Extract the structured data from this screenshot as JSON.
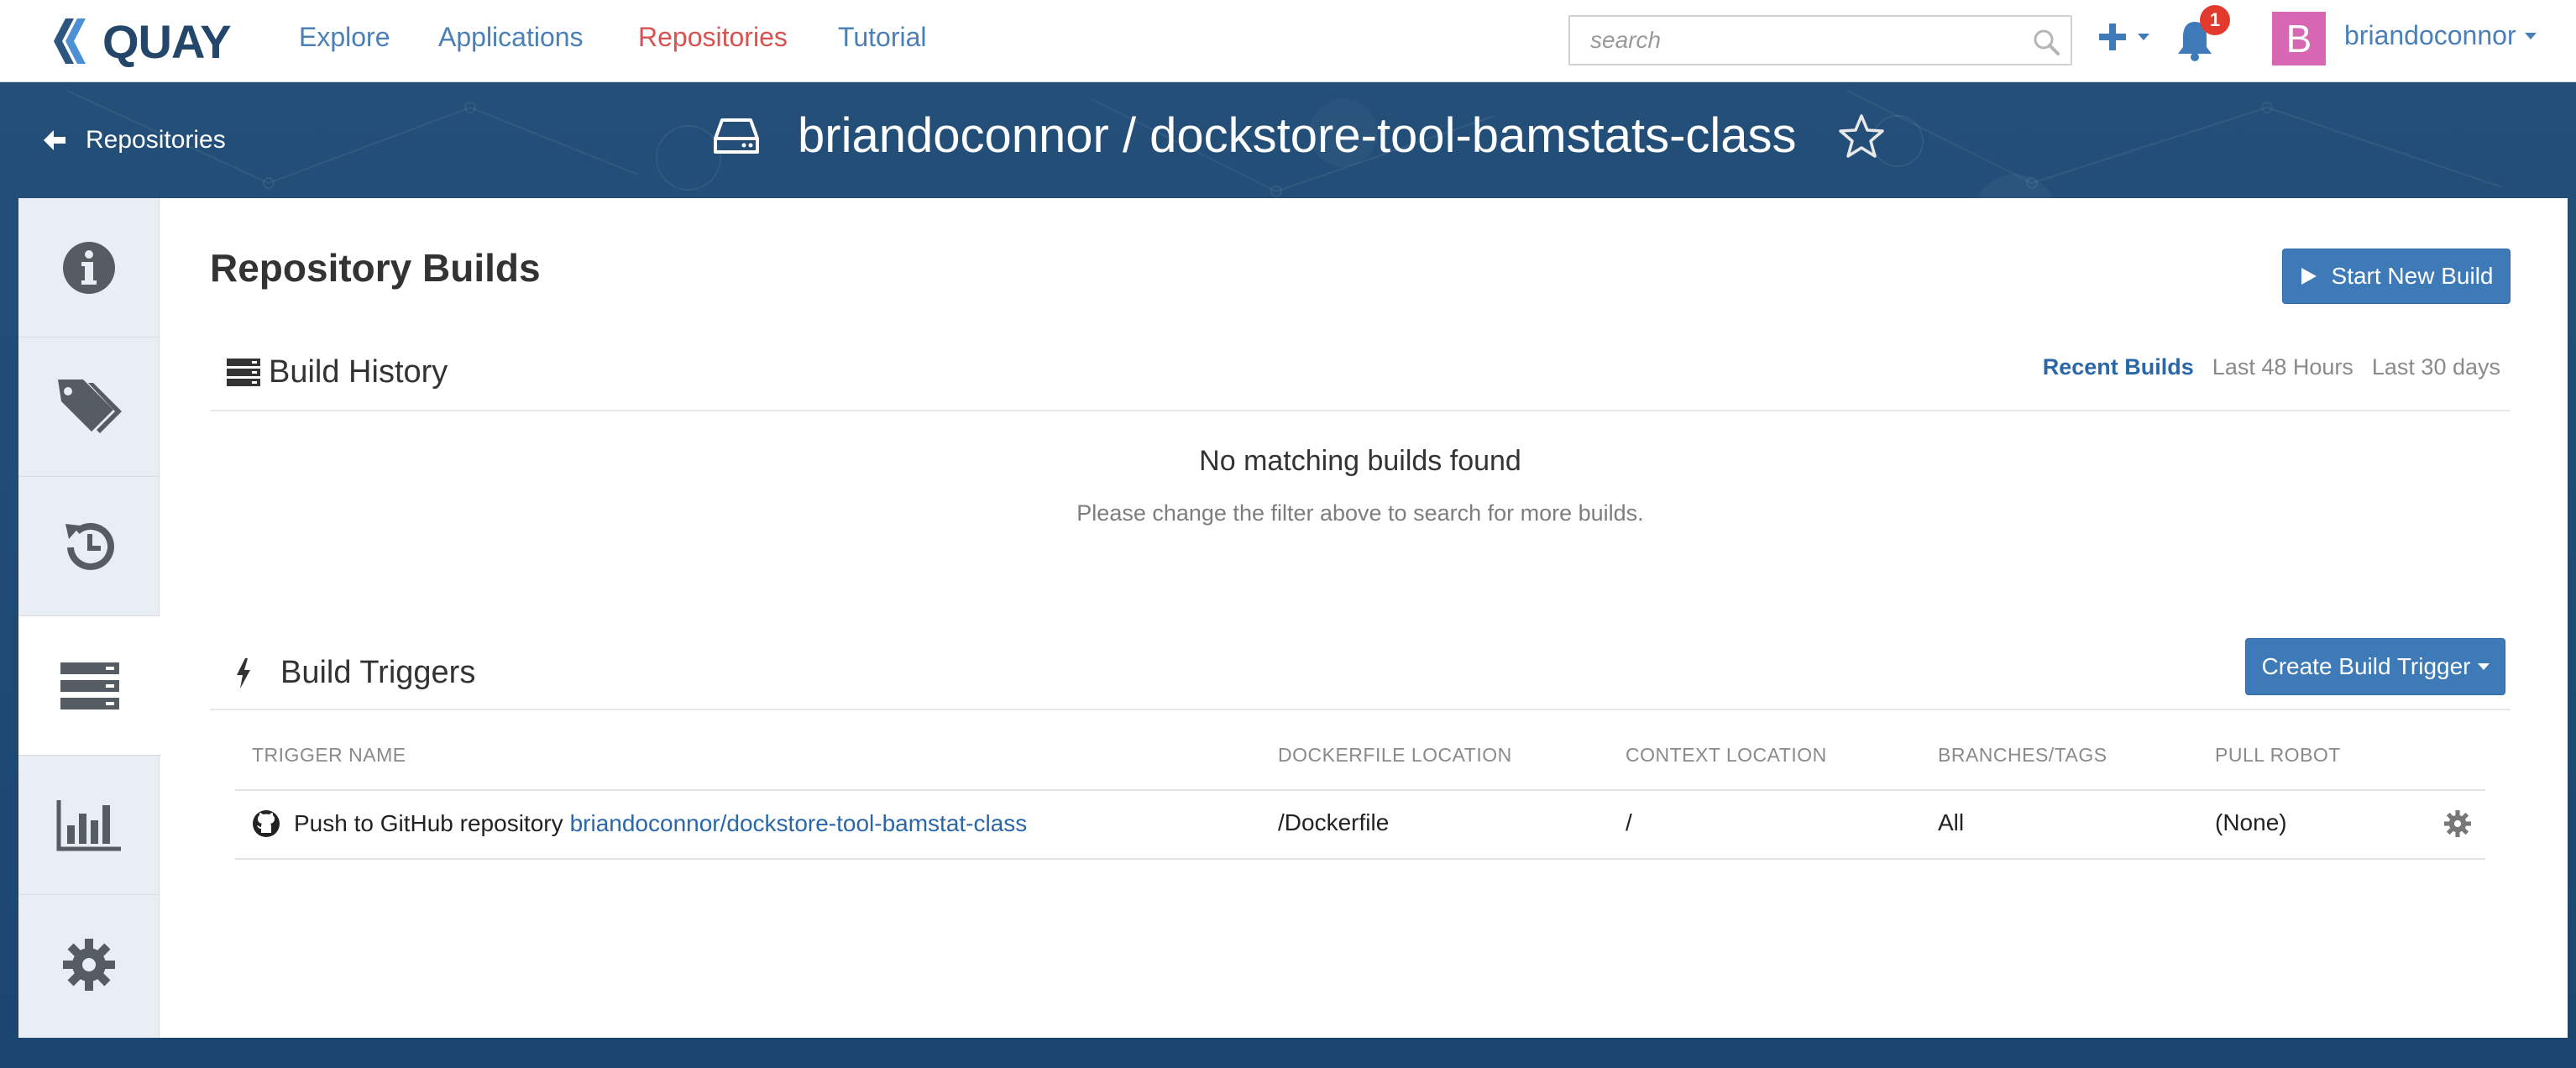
{
  "nav": {
    "brand": "QUAY",
    "links": [
      {
        "label": "Explore",
        "active": false
      },
      {
        "label": "Applications",
        "active": false
      },
      {
        "label": "Repositories",
        "active": true
      },
      {
        "label": "Tutorial",
        "active": false
      }
    ],
    "search_placeholder": "search",
    "notification_count": "1",
    "avatar_letter": "B",
    "username": "briandoconnor"
  },
  "header": {
    "back_label": "Repositories",
    "repo_title": "briandoconnor / dockstore-tool-bamstats-class"
  },
  "sidebar": {
    "items": [
      {
        "icon": "info-icon",
        "active": false
      },
      {
        "icon": "tags-icon",
        "active": false
      },
      {
        "icon": "history-icon",
        "active": false
      },
      {
        "icon": "builds-icon",
        "active": true
      },
      {
        "icon": "usage-chart-icon",
        "active": false
      },
      {
        "icon": "settings-gear-icon",
        "active": false
      }
    ]
  },
  "builds": {
    "page_title": "Repository Builds",
    "start_button": "Start New Build",
    "history_title": "Build History",
    "filters": [
      "Recent Builds",
      "Last 48 Hours",
      "Last 30 days"
    ],
    "active_filter": "Recent Builds",
    "empty_title": "No matching builds found",
    "empty_subtitle": "Please change the filter above to search for more builds."
  },
  "triggers": {
    "title": "Build Triggers",
    "create_button": "Create Build Trigger",
    "columns": [
      "TRIGGER NAME",
      "DOCKERFILE LOCATION",
      "CONTEXT LOCATION",
      "BRANCHES/TAGS",
      "PULL ROBOT"
    ],
    "rows": [
      {
        "name_prefix": "Push to GitHub repository",
        "repo_link": "briandoconnor/dockstore-tool-bamstat-class",
        "dockerfile": "/Dockerfile",
        "context": "/",
        "branches": "All",
        "robot": "(None)"
      }
    ]
  },
  "colors": {
    "accent": "#3f7ab8",
    "active_nav": "#d8534f",
    "header_band": "#1f4a72",
    "badge": "#e23a2c",
    "avatar": "#d767b2"
  }
}
